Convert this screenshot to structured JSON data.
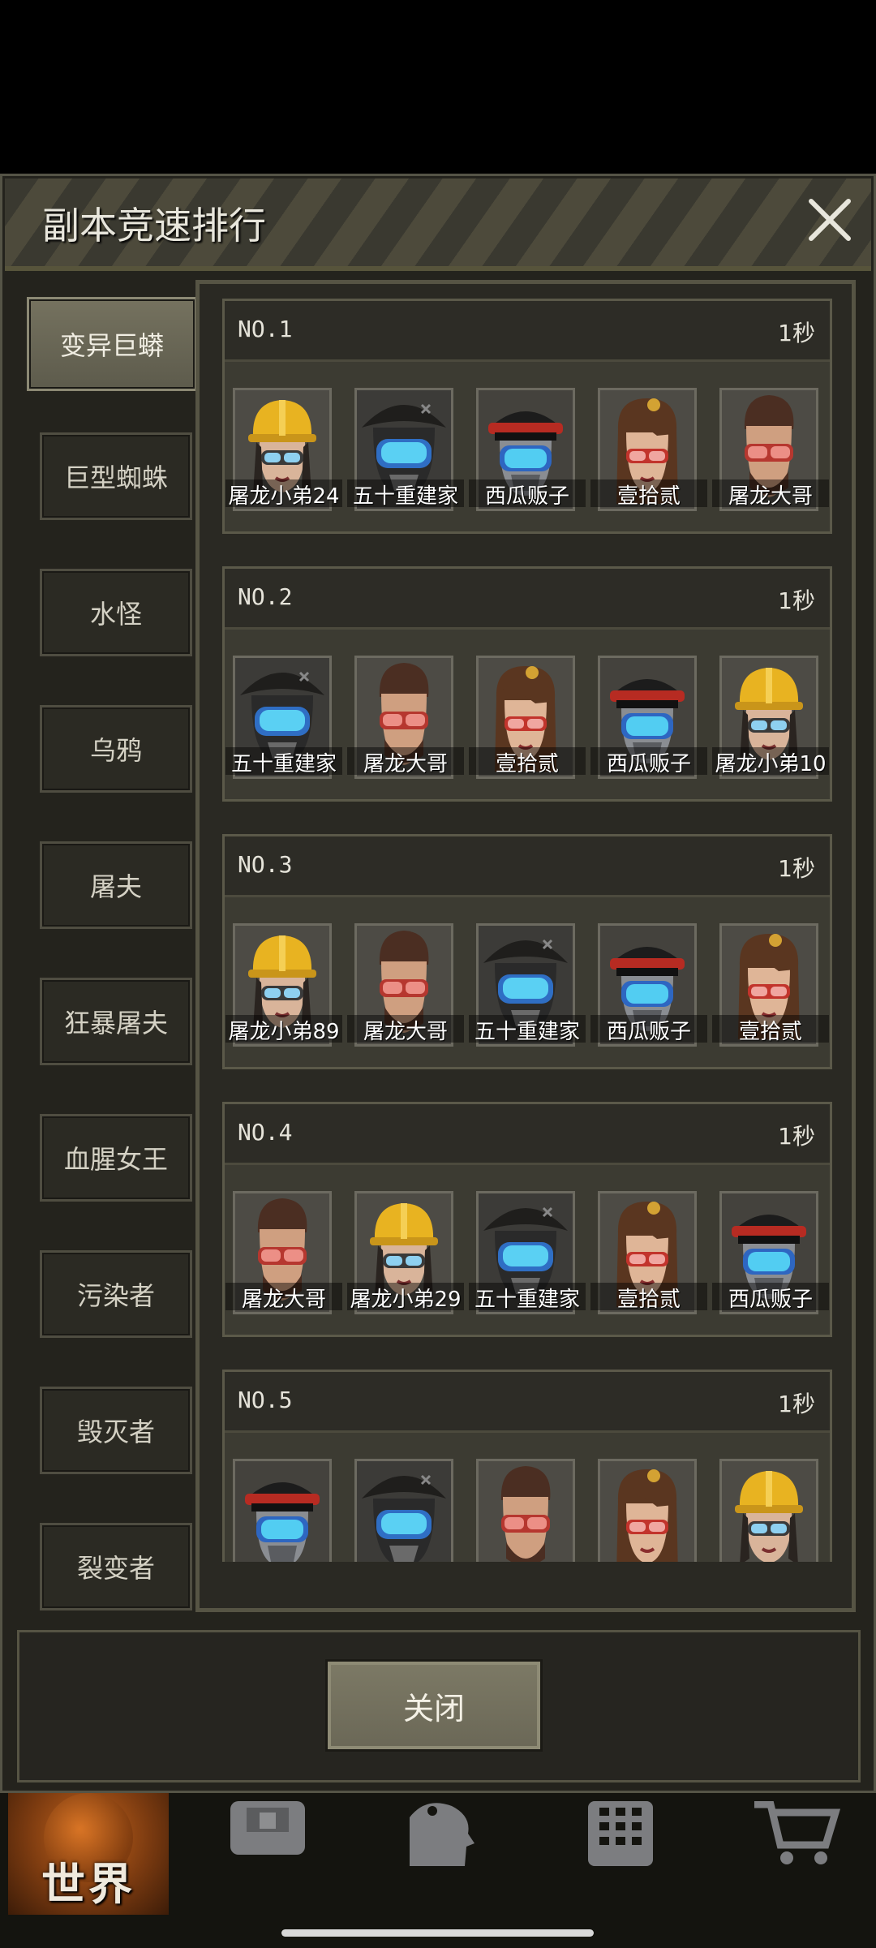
{
  "dialog": {
    "title": "副本竞速排行",
    "close_icon": "close-icon",
    "close_button_label": "关闭"
  },
  "tabs": [
    {
      "label": "变异巨蟒",
      "active": true
    },
    {
      "label": "巨型蜘蛛",
      "active": false
    },
    {
      "label": "水怪",
      "active": false
    },
    {
      "label": "乌鸦",
      "active": false
    },
    {
      "label": "屠夫",
      "active": false
    },
    {
      "label": "狂暴屠夫",
      "active": false
    },
    {
      "label": "血腥女王",
      "active": false
    },
    {
      "label": "污染者",
      "active": false
    },
    {
      "label": "毁灭者",
      "active": false
    },
    {
      "label": "裂变者",
      "active": false
    }
  ],
  "rankings": [
    {
      "rank": "NO.1",
      "time": "1秒",
      "members": [
        {
          "name": "屠龙小弟24",
          "avatar": "hardhat"
        },
        {
          "name": "五十重建家",
          "avatar": "tricorn"
        },
        {
          "name": "西瓜贩子",
          "avatar": "officer"
        },
        {
          "name": "壹拾贰",
          "avatar": "girl"
        },
        {
          "name": "屠龙大哥",
          "avatar": "man"
        }
      ]
    },
    {
      "rank": "NO.2",
      "time": "1秒",
      "members": [
        {
          "name": "五十重建家",
          "avatar": "tricorn"
        },
        {
          "name": "屠龙大哥",
          "avatar": "man"
        },
        {
          "name": "壹拾贰",
          "avatar": "girl"
        },
        {
          "name": "西瓜贩子",
          "avatar": "officer"
        },
        {
          "name": "屠龙小弟10",
          "avatar": "hardhat"
        }
      ]
    },
    {
      "rank": "NO.3",
      "time": "1秒",
      "members": [
        {
          "name": "屠龙小弟89",
          "avatar": "hardhat"
        },
        {
          "name": "屠龙大哥",
          "avatar": "man"
        },
        {
          "name": "五十重建家",
          "avatar": "tricorn"
        },
        {
          "name": "西瓜贩子",
          "avatar": "officer"
        },
        {
          "name": "壹拾贰",
          "avatar": "girl"
        }
      ]
    },
    {
      "rank": "NO.4",
      "time": "1秒",
      "members": [
        {
          "name": "屠龙大哥",
          "avatar": "man"
        },
        {
          "name": "屠龙小弟29",
          "avatar": "hardhat"
        },
        {
          "name": "五十重建家",
          "avatar": "tricorn"
        },
        {
          "name": "壹拾贰",
          "avatar": "girl"
        },
        {
          "name": "西瓜贩子",
          "avatar": "officer"
        }
      ]
    },
    {
      "rank": "NO.5",
      "time": "1秒",
      "members": [
        {
          "name": "",
          "avatar": "officer"
        },
        {
          "name": "",
          "avatar": "tricorn"
        },
        {
          "name": "",
          "avatar": "man"
        },
        {
          "name": "",
          "avatar": "girl"
        },
        {
          "name": "",
          "avatar": "hardhat"
        }
      ]
    }
  ],
  "bottom_nav": {
    "world_label": "世界",
    "icons": [
      "backpack-icon",
      "character-icon",
      "phone-icon",
      "shop-cart-icon"
    ]
  }
}
